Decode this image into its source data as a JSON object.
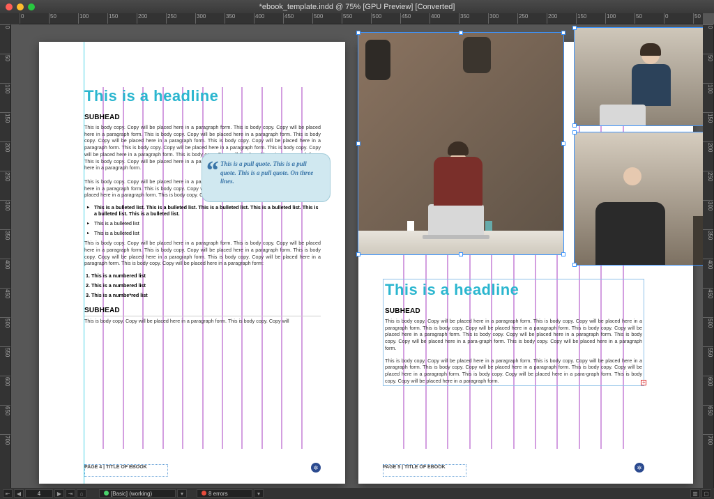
{
  "window": {
    "title": "*ebook_template.indd @ 75% [GPU Preview] [Converted]",
    "zoom": "75%"
  },
  "ruler_ticks_h": [
    "0",
    "50",
    "100",
    "150",
    "200",
    "250",
    "300",
    "350",
    "400",
    "450",
    "500",
    "550",
    "500",
    "450",
    "400",
    "350",
    "300",
    "250",
    "200",
    "150",
    "100",
    "50",
    "0",
    "50"
  ],
  "ruler_ticks_v": [
    "0",
    "50",
    "100",
    "150",
    "200",
    "250",
    "300",
    "350",
    "400",
    "450",
    "500",
    "550",
    "600",
    "650",
    "700"
  ],
  "page_left": {
    "headline": "This is a headline",
    "subhead1": "SUBHEAD",
    "body1": "This is body copy. Copy will be placed here in a paragraph form. This is body copy. Copy will be placed here in a paragraph form. This is body copy. Copy will be placed here in a paragraph form. This is body copy. Copy will be placed here in a paragraph form. This is body copy. Copy will be placed here in a paragraph form. This is body copy. Copy will be placed here in a paragraph form. This is body copy. Copy will be placed here in a paragraph form. This is body copy. Copy will be placed here in a paragraph form. This is body copy. Copy will be placed here in a paragraph form. This is body copy. Copy will be placed here in a paragraph form.",
    "pullquote": "This is a pull quote. This is a pull quote. This is a pull quote. On three lines.",
    "body2": "This is body copy. Copy will be placed here in a paragraph form. This is body copy. Copy will be placed here in a paragraph form. This is body copy. Copy will be placed here in a paragraph form. Copy will be placed here in a paragraph form. This is body copy. Copy will be placed here in a paragraph form.",
    "bullets": [
      "This is a bulleted list. This is a bulleted list. This is a bulleted list. This is a bulleted list. This is a bulleted list. This is a bulleted list.",
      "This is a bulleted list",
      "This is a bulleted list"
    ],
    "body3": "This is body copy. Copy will be placed here in a paragraph form. This is body copy. Copy will be placed here in a paragraph form. This is body copy. Copy will be placed here in a paragraph form. This is body copy. Copy will be placed here in a paragraph form. This is body copy. Copy will be placed here in a paragraph form. This is body copy. Copy will be placed here in a paragraph form:",
    "numbers": [
      "This is a numbered list",
      "This is a numbered list",
      "This is a numbe*red list"
    ],
    "subhead2": "SUBHEAD",
    "body4": "This is body copy. Copy will be placed here in a paragraph form. This is body copy. Copy will",
    "footer": "PAGE 4  |  TITLE OF EBOOK"
  },
  "page_right": {
    "headline": "This is a headline",
    "subhead": "SUBHEAD",
    "body1": "This is body copy. Copy will be placed here in a paragraph form. This is body copy. Copy will be placed here in a paragraph form. This is body copy. Copy will be placed here in a paragraph form. This is body copy. Copy will be placed here in a paragraph form. This is body copy. Copy will be placed here in a paragraph form. This is body copy. Copy will be placed here in a para-graph form. This is body copy. Copy will be placed here in a paragraph form.",
    "body2": "This is body copy. Copy will be placed here in a paragraph form. This is body copy. Copy will be placed here in a paragraph form. This is body copy. Copy will be placed here in a paragraph form. This is body copy. Copy will be placed here in a paragraph form. This is body copy. Copy will be placed here in a para-graph form. This is body copy. Copy will be placed here in a paragraph form.",
    "footer": "PAGE 5  |  TITLE OF EBOOK",
    "images": {
      "main": "photo-coworking-man-laptop",
      "top_right": "photo-beard-man-desk",
      "bottom_right": "photo-man-sitting"
    }
  },
  "statusbar": {
    "page_field": "4",
    "style_label": "[Basic] (working)",
    "errors_label": "8 errors"
  },
  "colors": {
    "headline": "#2bb6cf",
    "pullquote_bg": "#d0e8f0",
    "pullquote_text": "#3975a8",
    "guide": "#d39ee0"
  }
}
